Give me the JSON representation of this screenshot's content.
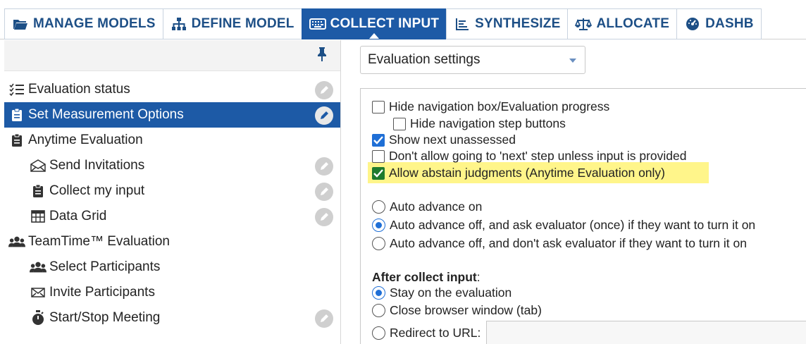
{
  "tabs": [
    {
      "label": "MANAGE MODELS",
      "icon": "folder-icon",
      "active": false
    },
    {
      "label": "DEFINE MODEL",
      "icon": "hierarchy-icon",
      "active": false
    },
    {
      "label": "COLLECT INPUT",
      "icon": "keyboard-icon",
      "active": true
    },
    {
      "label": "SYNTHESIZE",
      "icon": "bar-list-icon",
      "active": false
    },
    {
      "label": "ALLOCATE",
      "icon": "scales-icon",
      "active": false
    },
    {
      "label": "DASHB",
      "icon": "gauge-icon",
      "active": false
    }
  ],
  "tree": [
    {
      "label": "Evaluation status",
      "icon": "checklist-icon",
      "level": 0,
      "selected": false,
      "edit": true
    },
    {
      "label": "Set Measurement Options",
      "icon": "clipboard-icon",
      "level": 0,
      "selected": true,
      "edit": true
    },
    {
      "label": "Anytime Evaluation",
      "icon": "clipboard-icon",
      "level": 0,
      "selected": false,
      "edit": false
    },
    {
      "label": "Send Invitations",
      "icon": "envelope-open-icon",
      "level": 1,
      "selected": false,
      "edit": true
    },
    {
      "label": "Collect my input",
      "icon": "clipboard-icon",
      "level": 1,
      "selected": false,
      "edit": true
    },
    {
      "label": "Data Grid",
      "icon": "table-icon",
      "level": 1,
      "selected": false,
      "edit": true
    },
    {
      "label": "TeamTime™ Evaluation",
      "icon": "users-icon",
      "level": 0,
      "selected": false,
      "edit": false
    },
    {
      "label": "Select Participants",
      "icon": "users-icon",
      "level": 1,
      "selected": false,
      "edit": false
    },
    {
      "label": "Invite Participants",
      "icon": "envelope-icon",
      "level": 1,
      "selected": false,
      "edit": false
    },
    {
      "label": "Start/Stop Meeting",
      "icon": "stopwatch-icon",
      "level": 1,
      "selected": false,
      "edit": true
    }
  ],
  "settings_select": {
    "value": "Evaluation settings"
  },
  "checkboxes": [
    {
      "label": "Hide navigation box/Evaluation progress",
      "checked": false
    },
    {
      "label": "Hide navigation step buttons",
      "checked": false
    },
    {
      "label": "Show next unassessed",
      "checked": true
    },
    {
      "label": "Don't allow going to 'next' step unless input is provided",
      "checked": false
    },
    {
      "label": "Allow abstain judgments (Anytime Evaluation only)",
      "checked": true
    }
  ],
  "auto_advance": [
    {
      "label": "Auto advance on",
      "selected": false
    },
    {
      "label": "Auto advance off, and ask evaluator (once) if they want to turn it on",
      "selected": true
    },
    {
      "label": "Auto advance off, and don't ask evaluator if they want to turn it on",
      "selected": false
    }
  ],
  "after_collect": {
    "heading": "After collect input",
    "colon": ":",
    "options": [
      {
        "label": "Stay on the evaluation",
        "selected": true
      },
      {
        "label": "Close browser window (tab)",
        "selected": false
      },
      {
        "label": "Redirect to URL:",
        "selected": false
      }
    ],
    "url_value": ""
  },
  "colors": {
    "accent": "#1d5aa6",
    "highlight": "#fff58a",
    "check_green": "#1e7b2d"
  }
}
